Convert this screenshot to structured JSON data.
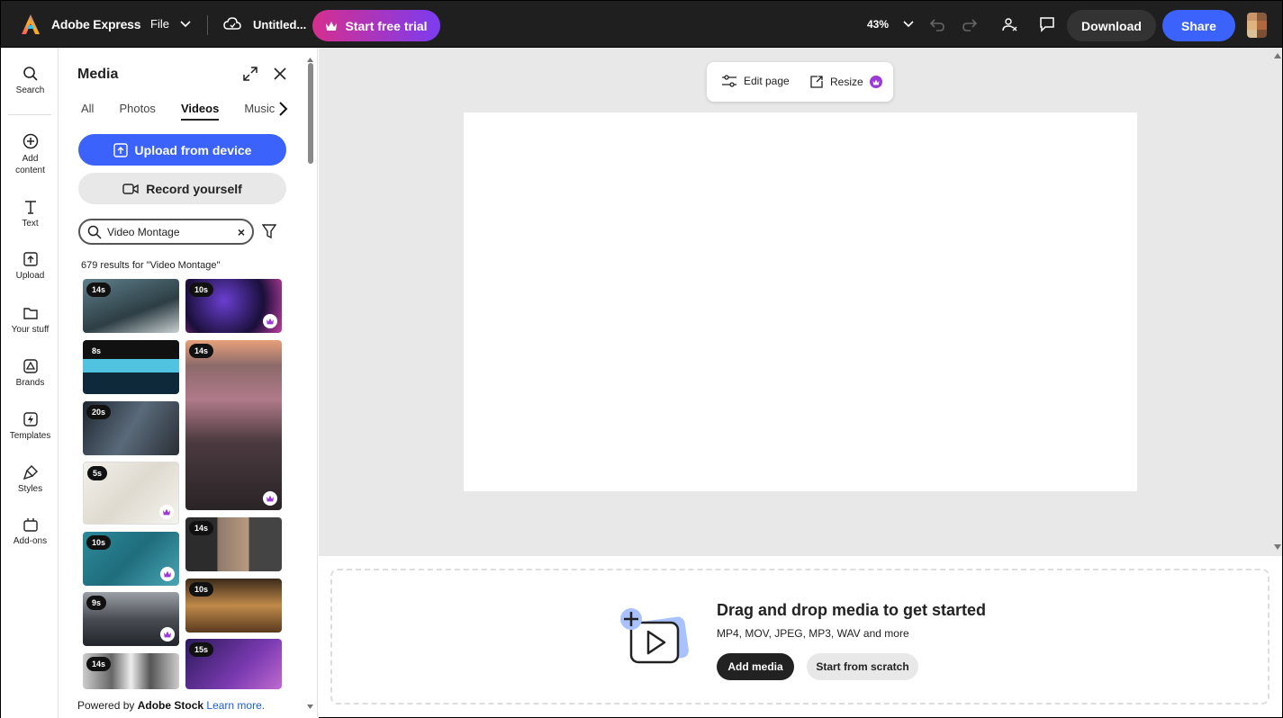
{
  "header": {
    "app_name": "Adobe Express",
    "file_menu": "File",
    "doc_title": "Untitled...",
    "trial_button": "Start free trial",
    "zoom": "43%",
    "download_button": "Download",
    "share_button": "Share",
    "trial_gradient": [
      "#d52f8e",
      "#7b3cf0"
    ],
    "share_color": "#3b63fb"
  },
  "rail": {
    "items": [
      {
        "label": "Search",
        "icon": "search-icon"
      },
      {
        "label": "Add content",
        "icon": "plus-circle-icon"
      },
      {
        "label": "Text",
        "icon": "text-icon"
      },
      {
        "label": "Upload",
        "icon": "upload-icon"
      },
      {
        "label": "Your stuff",
        "icon": "folder-icon"
      },
      {
        "label": "Brands",
        "icon": "brand-icon"
      },
      {
        "label": "Templates",
        "icon": "templates-icon"
      },
      {
        "label": "Styles",
        "icon": "brush-icon"
      },
      {
        "label": "Add-ons",
        "icon": "addons-icon"
      }
    ]
  },
  "media_panel": {
    "title": "Media",
    "tabs": [
      "All",
      "Photos",
      "Videos",
      "Music"
    ],
    "active_tab": "Videos",
    "upload_button": "Upload from device",
    "record_button": "Record yourself",
    "search_value": "Video Montage",
    "results_text": "679 results for \"Video Montage\"",
    "thumbnails": [
      {
        "duration": "14s",
        "premium": false
      },
      {
        "duration": "10s",
        "premium": true
      },
      {
        "duration": "8s",
        "premium": false
      },
      {
        "duration": "14s",
        "premium": true
      },
      {
        "duration": "20s",
        "premium": false
      },
      {
        "duration": "5s",
        "premium": true
      },
      {
        "duration": "14s",
        "premium": false
      },
      {
        "duration": "10s",
        "premium": true
      },
      {
        "duration": "10s",
        "premium": false
      },
      {
        "duration": "9s",
        "premium": true
      },
      {
        "duration": "15s",
        "premium": false
      },
      {
        "duration": "14s",
        "premium": true
      }
    ],
    "powered_prefix": "Powered by",
    "powered_brand": "Adobe Stock",
    "learn_more": "Learn more."
  },
  "canvas": {
    "edit_page": "Edit page",
    "resize": "Resize"
  },
  "dropzone": {
    "title": "Drag and drop media to get started",
    "subtitle": "MP4, MOV, JPEG, MP3, WAV and more",
    "add_media": "Add media",
    "start_scratch": "Start from scratch"
  }
}
